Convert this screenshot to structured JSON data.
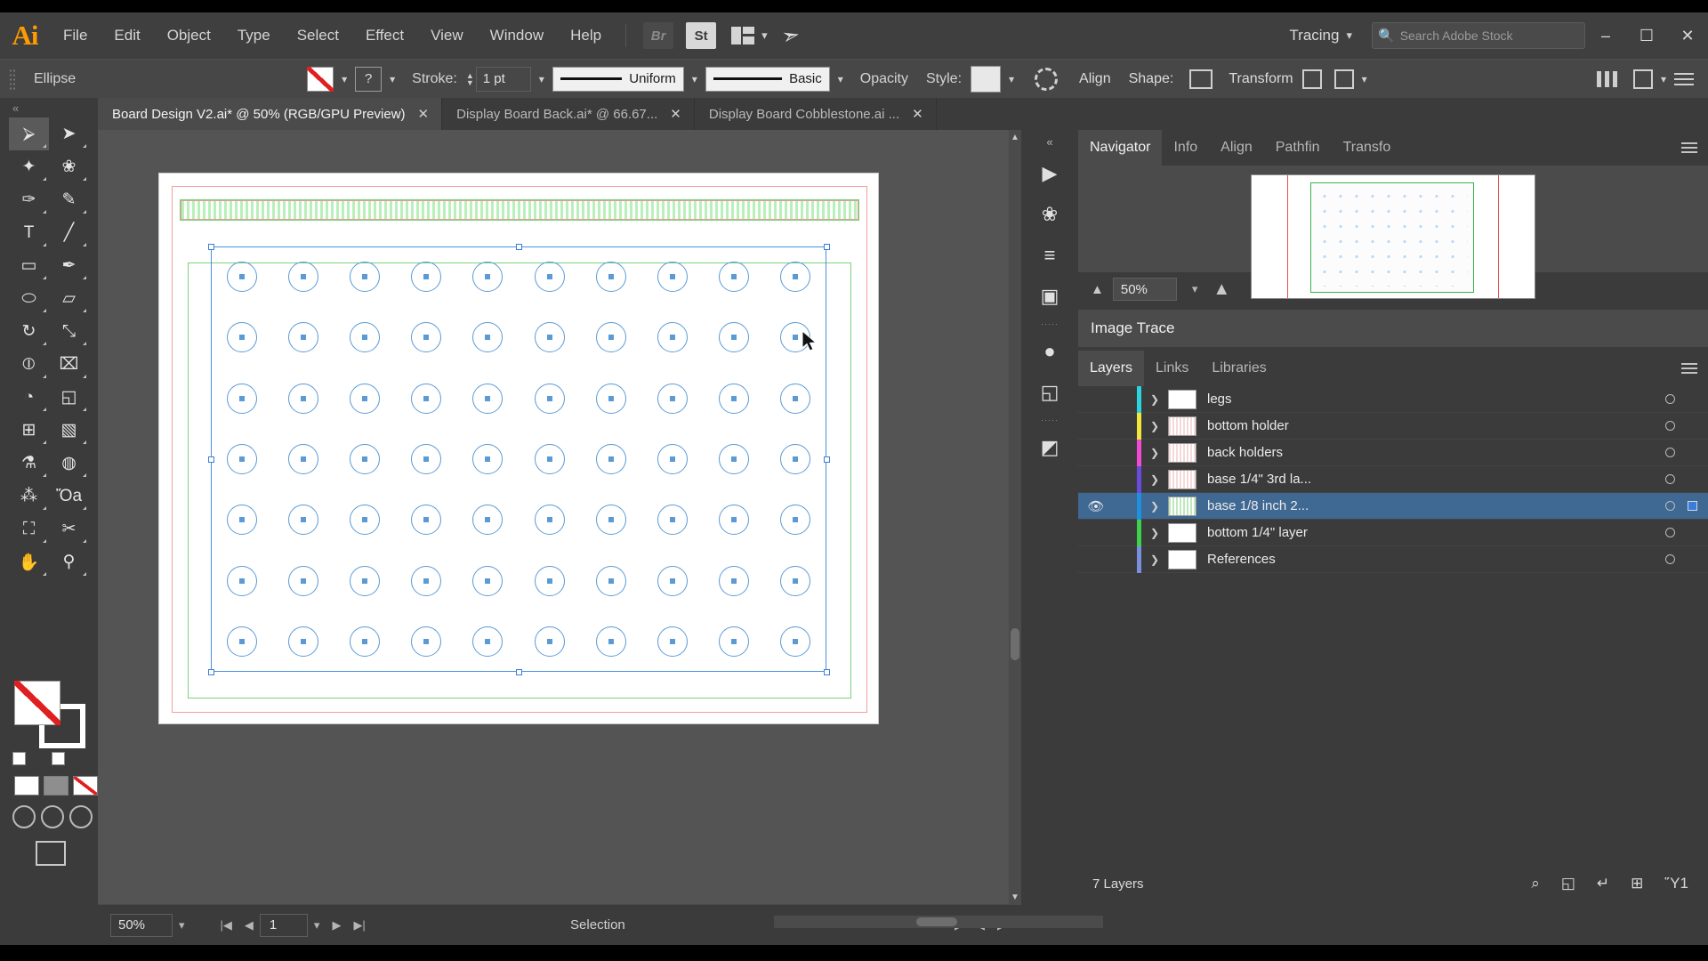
{
  "app": {
    "logo": "Ai",
    "name": "Adobe Illustrator"
  },
  "menubar": {
    "items": [
      "File",
      "Edit",
      "Object",
      "Type",
      "Select",
      "Effect",
      "View",
      "Window",
      "Help"
    ],
    "bridge_label": "Br",
    "stock_label": "St",
    "arrange_icon": "arrange-documents-icon",
    "rocket_icon": "discover-icon",
    "workspace": "Tracing",
    "search_placeholder": "Search Adobe Stock",
    "search_icon": "search-icon",
    "minimize": "–",
    "maximize": "☐",
    "close": "✕"
  },
  "controlbar": {
    "tool_label": "Ellipse",
    "fill_swatch": "none-fill",
    "stroke_swatch_label": "?",
    "stroke_label": "Stroke:",
    "stroke_weight": "1 pt",
    "profile": "Uniform",
    "brush": "Basic",
    "opacity_label": "Opacity",
    "style_label": "Style:",
    "transparency_icon": "transparency-grid-icon",
    "align_label": "Align",
    "shape_label": "Shape:",
    "transform_label": "Transform",
    "isolate_icon": "isolate-selected-icon",
    "distribute_icon": "distribute-icon",
    "options_icon": "more-options-icon",
    "panel_menu_icon": "panel-menu-icon"
  },
  "tabs": [
    {
      "label": "Board Design V2.ai* @ 50% (RGB/GPU Preview)",
      "active": true,
      "close": "✕"
    },
    {
      "label": "Display Board Back.ai* @ 66.67...",
      "active": false,
      "close": "✕"
    },
    {
      "label": "Display Board Cobblestone.ai ...",
      "active": false,
      "close": "✕"
    }
  ],
  "toolbar": {
    "collapse_icon": "collapse-panel-icon",
    "tools": [
      {
        "name": "selection-tool",
        "glyph": "⮚",
        "selected": true
      },
      {
        "name": "direct-selection-tool",
        "glyph": "➤",
        "selected": false
      },
      {
        "name": "magic-wand-tool",
        "glyph": "✦",
        "selected": false
      },
      {
        "name": "lasso-tool",
        "glyph": "❀",
        "selected": false
      },
      {
        "name": "pen-tool",
        "glyph": "✑",
        "selected": false
      },
      {
        "name": "curvature-tool",
        "glyph": "✎",
        "selected": false
      },
      {
        "name": "type-tool",
        "glyph": "T",
        "selected": false
      },
      {
        "name": "line-segment-tool",
        "glyph": "╱",
        "selected": false
      },
      {
        "name": "rectangle-tool",
        "glyph": "▭",
        "selected": false
      },
      {
        "name": "paintbrush-tool",
        "glyph": "✒",
        "selected": false
      },
      {
        "name": "ellipse-tool",
        "glyph": "⬭",
        "selected": false
      },
      {
        "name": "eraser-tool",
        "glyph": "▱",
        "selected": false
      },
      {
        "name": "rotate-tool",
        "glyph": "↻",
        "selected": false
      },
      {
        "name": "scale-tool",
        "glyph": "⤡",
        "selected": false
      },
      {
        "name": "width-tool",
        "glyph": "⦶",
        "selected": false
      },
      {
        "name": "free-transform-tool",
        "glyph": "⌧",
        "selected": false
      },
      {
        "name": "shape-builder-tool",
        "glyph": "◔",
        "selected": false
      },
      {
        "name": "perspective-grid-tool",
        "glyph": "◱",
        "selected": false
      },
      {
        "name": "mesh-tool",
        "glyph": "⊞",
        "selected": false
      },
      {
        "name": "gradient-tool",
        "glyph": "▧",
        "selected": false
      },
      {
        "name": "eyedropper-tool",
        "glyph": "⚗",
        "selected": false
      },
      {
        "name": "blend-tool",
        "glyph": "◍",
        "selected": false
      },
      {
        "name": "symbol-sprayer-tool",
        "glyph": "⁂",
        "selected": false
      },
      {
        "name": "column-graph-tool",
        "glyph": "Ὄa",
        "selected": false
      },
      {
        "name": "artboard-tool",
        "glyph": "⛶",
        "selected": false
      },
      {
        "name": "slice-tool",
        "glyph": "✂",
        "selected": false
      },
      {
        "name": "hand-tool",
        "glyph": "✋",
        "selected": false
      },
      {
        "name": "zoom-tool",
        "glyph": "⚲",
        "selected": false
      }
    ],
    "fill_name": "fill-swatch-none",
    "stroke_name": "stroke-swatch-white",
    "color_modes": [
      "color-mode",
      "gradient-mode",
      "none-mode"
    ],
    "screen_mode": "change-screen-mode"
  },
  "canvas": {
    "artboard_name": "artboard",
    "grid_cols": 10,
    "grid_rows": 7,
    "accent_blue": "#5b9bd5",
    "guide_red": "#f2a0a0",
    "guide_green": "#7ad17a"
  },
  "statusbar": {
    "zoom": "50%",
    "first_icon": "first-artboard-icon",
    "prev_icon": "previous-artboard-icon",
    "page": "1",
    "next_icon": "next-artboard-icon",
    "last_icon": "last-artboard-icon",
    "status_text": "Selection",
    "play_icon": "play-icon"
  },
  "rail": {
    "collapse_icon": "expand-panels-icon",
    "icons": [
      {
        "name": "selection-panel-icon",
        "glyph": "▶"
      },
      {
        "name": "brushes-panel-icon",
        "glyph": "❀"
      },
      {
        "name": "align-panel-icon",
        "glyph": "≡"
      },
      {
        "name": "artboards-panel-icon",
        "glyph": "▣"
      },
      {
        "name": "color-guide-panel-icon",
        "glyph": "●"
      },
      {
        "name": "pathfinder-panel-icon",
        "glyph": "◱"
      },
      {
        "name": "image-trace-panel-icon",
        "glyph": "◩"
      }
    ]
  },
  "navigator": {
    "tabs": [
      "Navigator",
      "Info",
      "Align",
      "Pathfin",
      "Transfo"
    ],
    "active_tab": "Navigator",
    "zoom": "50%",
    "zoom_out_icon": "zoom-out-icon",
    "zoom_in_icon": "zoom-in-icon",
    "menu_icon": "panel-menu-icon"
  },
  "image_trace": {
    "title": "Image Trace"
  },
  "layers_panel": {
    "tabs": [
      "Layers",
      "Links",
      "Libraries"
    ],
    "active_tab": "Layers",
    "menu_icon": "panel-menu-icon",
    "rows": [
      {
        "name": "legs",
        "color": "#2ad4e0",
        "visible": false,
        "selected": false,
        "target": "○"
      },
      {
        "name": "bottom holder",
        "color": "#f0e63c",
        "visible": false,
        "selected": false,
        "target": "○"
      },
      {
        "name": "back holders",
        "color": "#f24ad7",
        "visible": false,
        "selected": false,
        "target": "○"
      },
      {
        "name": "base 1/4\" 3rd la...",
        "color": "#6b4ae0",
        "visible": false,
        "selected": false,
        "target": "○"
      },
      {
        "name": "base 1/8 inch 2...",
        "color": "#1f8fe0",
        "visible": true,
        "selected": true,
        "target": "○"
      },
      {
        "name": "bottom 1/4\" layer",
        "color": "#3ed14a",
        "visible": false,
        "selected": false,
        "target": "○"
      },
      {
        "name": "References",
        "color": "#7a8fe0",
        "visible": false,
        "selected": false,
        "target": "○"
      }
    ],
    "footer_count": "7 Layers",
    "footer_icons": [
      {
        "name": "locate-object-icon",
        "glyph": "⌕"
      },
      {
        "name": "make-clipping-mask-icon",
        "glyph": "◱"
      },
      {
        "name": "create-sublayer-icon",
        "glyph": "↵"
      },
      {
        "name": "create-new-layer-icon",
        "glyph": "⊞"
      },
      {
        "name": "delete-selection-icon",
        "glyph": "Ὕ1"
      }
    ]
  }
}
